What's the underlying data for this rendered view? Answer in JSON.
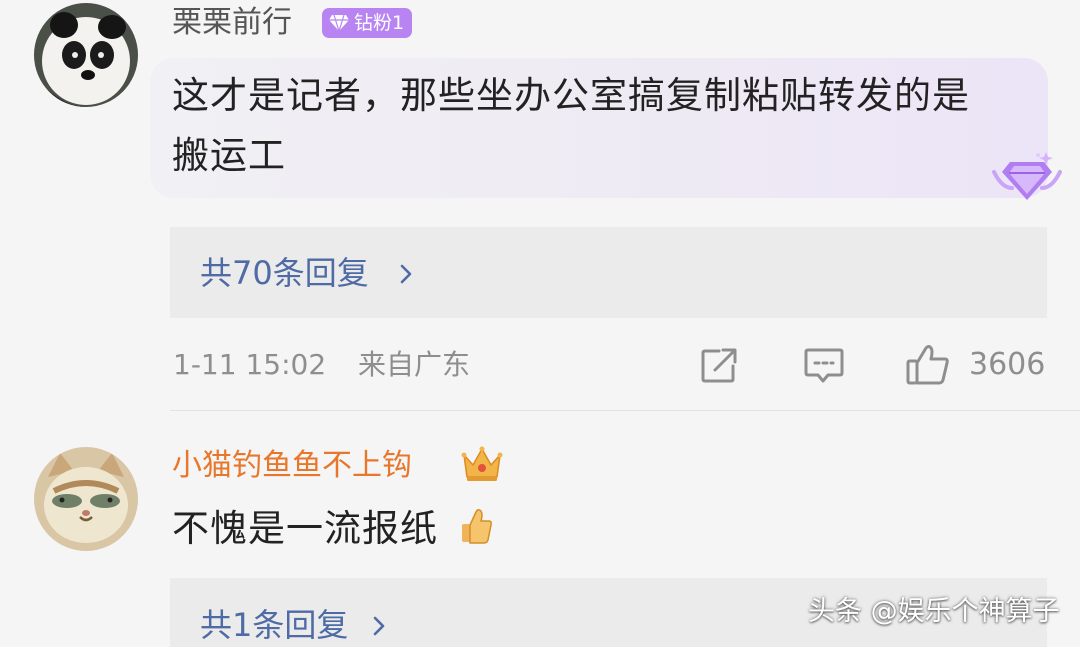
{
  "comments": [
    {
      "username": "栗栗前行",
      "badge": {
        "label": "钻粉1",
        "color": "#b884f2"
      },
      "text_lines": [
        "这才是记者，那些坐办公室搞复制粘贴转发的是",
        "搬运工"
      ],
      "decoration_icon": "purple-diamond-icon",
      "replies_label": "共70条回复",
      "timestamp": "1-11 15:02",
      "location": "来自广东",
      "like_count": "3606",
      "avatar_icon": "panda-avatar"
    },
    {
      "username": "小猫钓鱼鱼不上钩",
      "username_color": "#e8772b",
      "badge_icon": "crown-icon",
      "text": "不愧是一流报纸",
      "emoji": "thumbs-up-emoji",
      "replies_label": "共1条回复",
      "avatar_icon": "cat-with-fish-avatar"
    }
  ],
  "watermark": "头条 @娱乐个神算子",
  "colors": {
    "background": "#f5f5f5",
    "reply_link": "#4f6ba6",
    "meta_gray": "#8e8e8e"
  }
}
